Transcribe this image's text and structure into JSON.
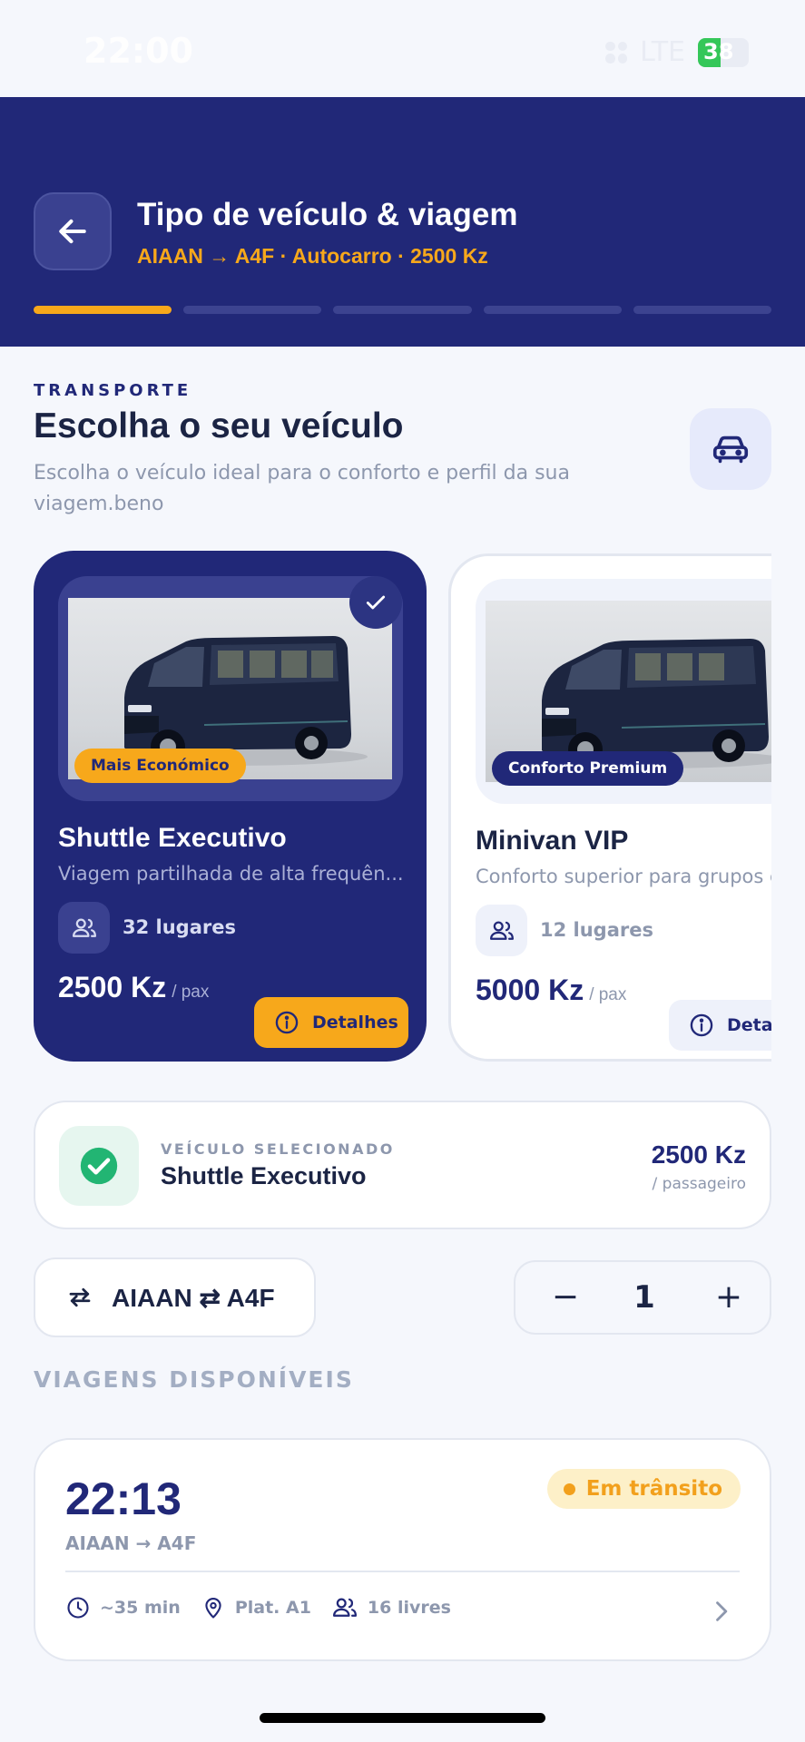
{
  "status_bar": {
    "time": "22:00",
    "network": "LTE",
    "battery": "38"
  },
  "header": {
    "title": "Tipo de veículo & viagem",
    "subtitle": "AIAAN → A4F · Autocarro · 2500 Kz",
    "steps_total": 5,
    "steps_active": 1
  },
  "section": {
    "eyebrow": "TRANSPORTE",
    "title": "Escolha o seu veículo",
    "description": "Escolha o veículo ideal para o conforto e perfil da sua viagem.beno"
  },
  "vehicles": [
    {
      "badge": "Mais Económico",
      "name": "Shuttle Executivo",
      "description": "Viagem partilhada de alta frequên...",
      "seats": "32 lugares",
      "price": "2500 Kz",
      "unit": "/ pax",
      "details_label": "Detalhes",
      "selected": true
    },
    {
      "badge": "Conforto Premium",
      "name": "Minivan VIP",
      "description": "Conforto superior para grupos e",
      "seats": "12 lugares",
      "price": "5000 Kz",
      "unit": "/ pax",
      "details_label": "Detal",
      "selected": false
    }
  ],
  "selected_summary": {
    "label": "VEÍCULO SELECIONADO",
    "name": "Shuttle Executivo",
    "price": "2500 Kz",
    "unit": "/ passageiro"
  },
  "route": {
    "from": "AIAAN",
    "to": "A4F"
  },
  "passengers": {
    "value": "1",
    "minus": "−",
    "plus": "+"
  },
  "trips_title": "VIAGENS DISPONÍVEIS",
  "trips": [
    {
      "time": "22:13",
      "route": "AIAAN → A4F",
      "status": "Em trânsito",
      "duration": "~35 min",
      "platform": "Plat. A1",
      "free_seats": "16 livres"
    }
  ],
  "colors": {
    "primary": "#212878",
    "accent": "#f7a81b",
    "success": "#22b573",
    "background": "#f5f7fc"
  }
}
